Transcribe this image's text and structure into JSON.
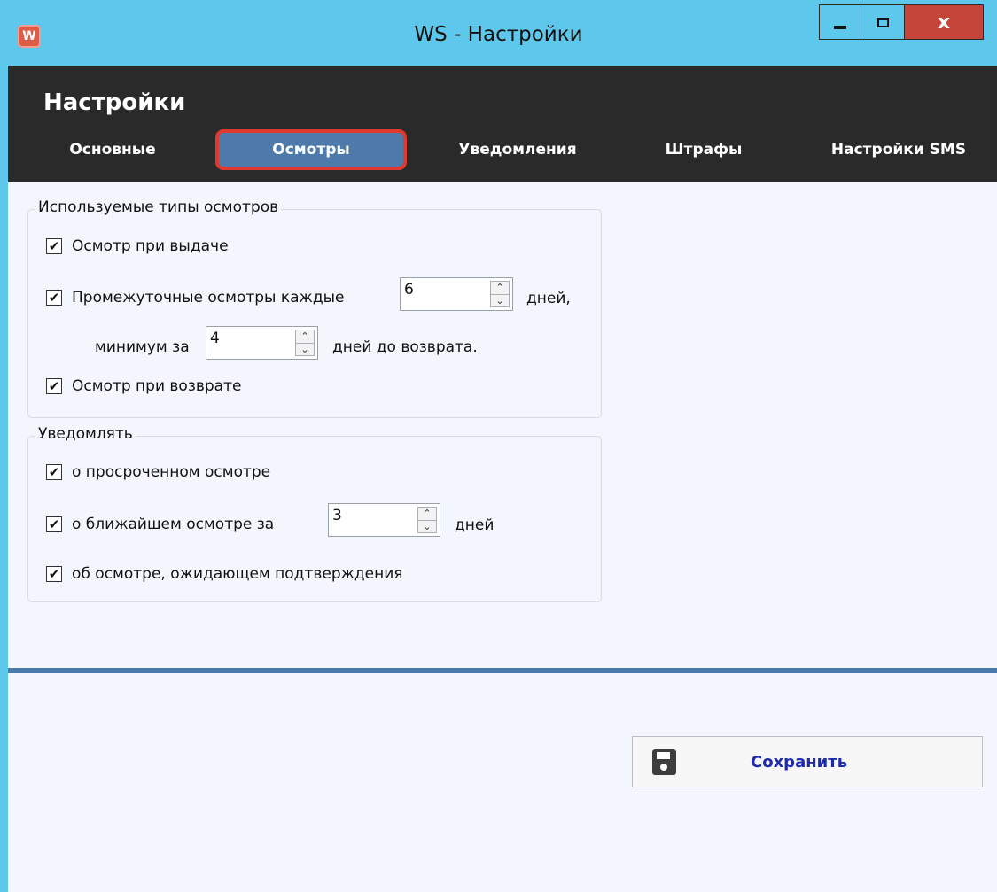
{
  "window": {
    "title": "WS - Настройки",
    "app_icon": "W",
    "close_glyph": "x"
  },
  "header": {
    "title": "Настройки",
    "tabs": [
      {
        "label": "Основные",
        "active": false
      },
      {
        "label": "Осмотры",
        "active": true
      },
      {
        "label": "Уведомления",
        "active": false
      },
      {
        "label": "Штрафы",
        "active": false
      },
      {
        "label": "Настройки SMS",
        "active": false
      }
    ]
  },
  "inspection_types": {
    "legend": "Используемые типы осмотров",
    "on_issue": {
      "label": "Осмотр при выдаче",
      "checked": true
    },
    "intermediate": {
      "label": "Промежуточные осмотры каждые",
      "checked": true,
      "every_value": "6",
      "days_suffix": "дней,",
      "min_label": "минимум за",
      "min_value": "4",
      "min_suffix": "дней до возврата."
    },
    "on_return": {
      "label": "Осмотр при возврате",
      "checked": true
    }
  },
  "notify": {
    "legend": "Уведомлять",
    "overdue": {
      "label": "о просроченном осмотре",
      "checked": true
    },
    "upcoming": {
      "label": "о ближайшем осмотре за",
      "checked": true,
      "value": "3",
      "suffix": "дней"
    },
    "pending": {
      "label": "об осмотре, ожидающем подтверждения",
      "checked": true
    }
  },
  "footer": {
    "save_label": "Сохранить"
  },
  "colors": {
    "titlebar": "#5ec8ec",
    "header_bg": "#2a2a2a",
    "active_tab": "#4d7aaa",
    "active_tab_highlight": "#e03a2f",
    "close_button": "#c6453a",
    "save_text": "#1e2aa8"
  },
  "glyphs": {
    "check": "✔",
    "spin_up": "⌃",
    "spin_down": "⌄"
  }
}
